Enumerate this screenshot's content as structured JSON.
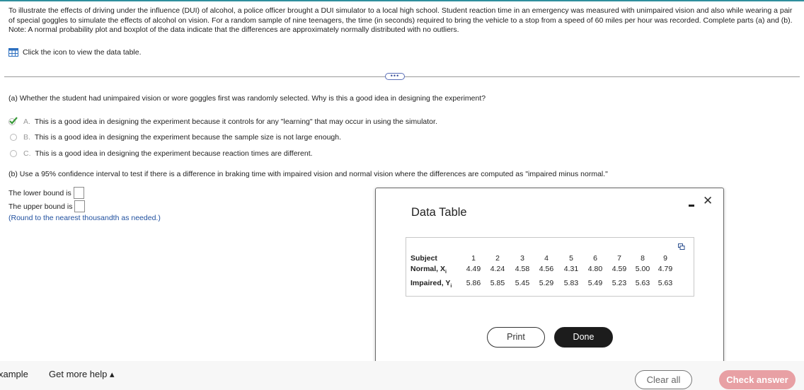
{
  "problem": {
    "intro": "To illustrate the effects of driving under the influence (DUI) of alcohol, a police officer brought a DUI simulator to a local high school. Student reaction time in an emergency was measured with unimpaired vision and also while wearing a pair of special goggles to simulate the effects of alcohol on vision. For a random sample of nine teenagers, the time (in seconds) required to bring the vehicle to a stop from a speed of 60 miles per hour was recorded. Complete parts (a) and (b).",
    "note": "Note: A normal probability plot and boxplot of the data indicate that the differences are approximately normally distributed with no outliers.",
    "data_link": "Click the icon to view the data table."
  },
  "more_pill": "•••",
  "part_a": {
    "question": "(a) Whether the student had unimpaired vision or wore goggles first was randomly selected. Why is this a good idea in designing the experiment?",
    "choices": [
      {
        "letter": "A.",
        "text": "This is a good idea in designing the experiment because it controls for any \"learning\" that may occur in using the simulator.",
        "selected": true
      },
      {
        "letter": "B.",
        "text": "This is a good idea in designing the experiment because the sample size is not large enough.",
        "selected": false
      },
      {
        "letter": "C.",
        "text": "This is a good idea in designing the experiment because reaction times are different.",
        "selected": false
      }
    ]
  },
  "part_b": {
    "question": "(b) Use a 95% confidence interval to test if there is a difference in braking time with impaired vision and normal vision where the differences are computed as \"impaired minus normal.\"",
    "lower_label": "The lower bound is",
    "lower_value": "",
    "upper_label": "The upper bound is",
    "upper_value": "",
    "hint": "(Round to the nearest thousandth as needed.)"
  },
  "modal": {
    "title": "Data Table",
    "row_labels": {
      "subject": "Subject",
      "normal": "Normal, X",
      "normal_sub": "i",
      "impaired": "Impaired, Y",
      "impaired_sub": "i"
    },
    "subjects": [
      "1",
      "2",
      "3",
      "4",
      "5",
      "6",
      "7",
      "8",
      "9"
    ],
    "normal": [
      "4.49",
      "4.24",
      "4.58",
      "4.56",
      "4.31",
      "4.80",
      "4.59",
      "5.00",
      "4.79"
    ],
    "impaired": [
      "5.86",
      "5.85",
      "5.45",
      "5.29",
      "5.83",
      "5.49",
      "5.23",
      "5.63",
      "5.63"
    ],
    "print_label": "Print",
    "done_label": "Done",
    "close_glyph": "✕"
  },
  "footer": {
    "example_label": "xample",
    "help_label": "Get more help ▴",
    "clear_label": "Clear all",
    "check_label": "Check answer"
  },
  "colors": {
    "accent": "#2f8f9d",
    "hint_blue": "#1f4f9e",
    "check_pink": "#e8a0a4",
    "correct_green": "#3a9a3a"
  }
}
